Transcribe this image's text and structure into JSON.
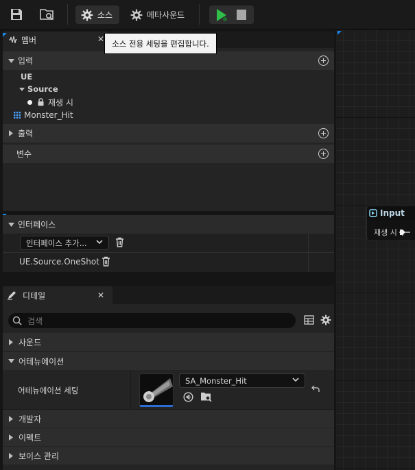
{
  "toolbar": {
    "source_label": "소스",
    "metasound_label": "메타사운드"
  },
  "tooltip": "소스 전용 세팅을 편집합니다.",
  "members": {
    "tab_label": "멤버",
    "inputs_label": "입력",
    "tree": {
      "ue": "UE",
      "source": "Source",
      "on_play": "재생 시",
      "monster_hit": "Monster_Hit"
    },
    "outputs_label": "출력",
    "variables_label": "변수"
  },
  "interfaces": {
    "header": "인터페이스",
    "add_combo": "인터페이스 추가...",
    "item": "UE.Source.OneShot"
  },
  "details": {
    "tab_label": "디테일",
    "search_placeholder": "검색",
    "sections": {
      "sound": "사운드",
      "attenuation": "어테뉴에이션",
      "developer": "개발자",
      "effects": "이펙트",
      "voice": "보이스 관리"
    },
    "attenuation_setting_label": "어테뉴에이션 세팅",
    "asset_name": "SA_Monster_Hit"
  },
  "graph": {
    "node_title": "Input",
    "pin_label": "재생 시"
  },
  "colors": {
    "play_green": "#2fbf4a",
    "accent_blue": "#1a86e8",
    "node_title": "#bcd6e6"
  }
}
